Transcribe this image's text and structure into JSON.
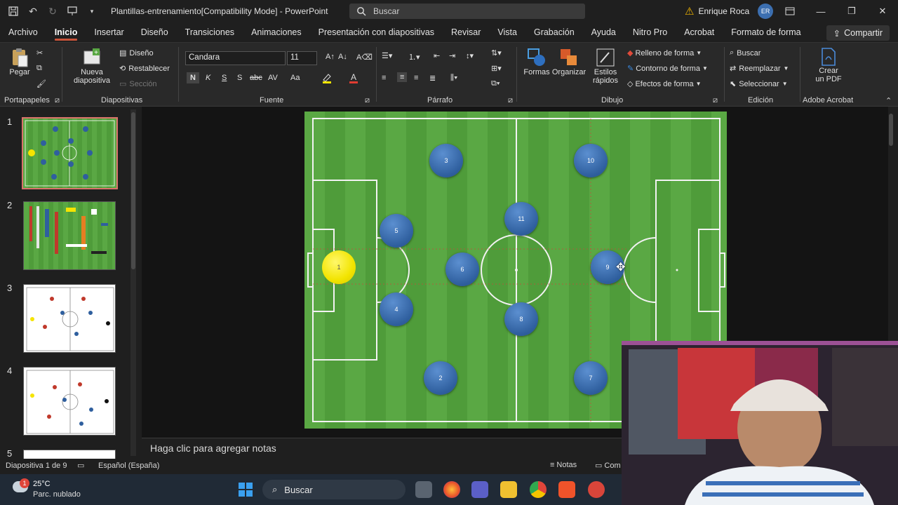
{
  "titlebar": {
    "title": "Plantillas-entrenamiento[Compatibility Mode]  -  PowerPoint",
    "search": "Buscar",
    "user_name": "Enrique Roca",
    "user_initials": "ER"
  },
  "menu": {
    "tabs": [
      "Archivo",
      "Inicio",
      "Insertar",
      "Diseño",
      "Transiciones",
      "Animaciones",
      "Presentación con diapositivas",
      "Revisar",
      "Vista",
      "Grabación",
      "Ayuda",
      "Nitro Pro",
      "Acrobat",
      "Formato de forma"
    ],
    "active": "Inicio",
    "share": "Compartir"
  },
  "ribbon": {
    "paste": "Pegar",
    "new_slide_1": "Nueva",
    "new_slide_2": "diapositiva",
    "layout": "Diseño",
    "reset": "Restablecer",
    "section": "Sección",
    "font_name": "Candara",
    "font_size": "11",
    "bold": "N",
    "italic": "K",
    "underline": "S",
    "strike": "S",
    "shapes": "Formas",
    "arrange": "Organizar",
    "quick_styles_1": "Estilos",
    "quick_styles_2": "rápidos",
    "fill": "Relleno de forma",
    "outline": "Contorno de forma",
    "effects": "Efectos de forma",
    "find": "Buscar",
    "replace": "Reemplazar",
    "select": "Seleccionar",
    "create_pdf_1": "Crear",
    "create_pdf_2": "un PDF",
    "groups": {
      "clipboard": "Portapapeles",
      "slides": "Diapositivas",
      "font": "Fuente",
      "paragraph": "Párrafo",
      "drawing": "Dibujo",
      "editing": "Edición",
      "acrobat": "Adobe Acrobat"
    }
  },
  "thumbnails": [
    "1",
    "2",
    "3",
    "4",
    "5"
  ],
  "slide": {
    "players": [
      "3",
      "10",
      "5",
      "11",
      "6",
      "9",
      "4",
      "8",
      "2",
      "7"
    ],
    "ball_label": "1"
  },
  "notes": "Haga clic para agregar notas",
  "status": {
    "slide_info": "Diapositiva 1 de 9",
    "language": "Español (España)",
    "notes_btn": "Notas",
    "comments_btn": "Com"
  },
  "taskbar": {
    "temp": "25°C",
    "weather": "Parc. nublado",
    "weather_badge": "1",
    "search": "Buscar"
  },
  "colors": {
    "accent": "#c9533a",
    "pitch": "#5aa844",
    "player": "#2f5f9e",
    "ball": "#f2e400"
  }
}
